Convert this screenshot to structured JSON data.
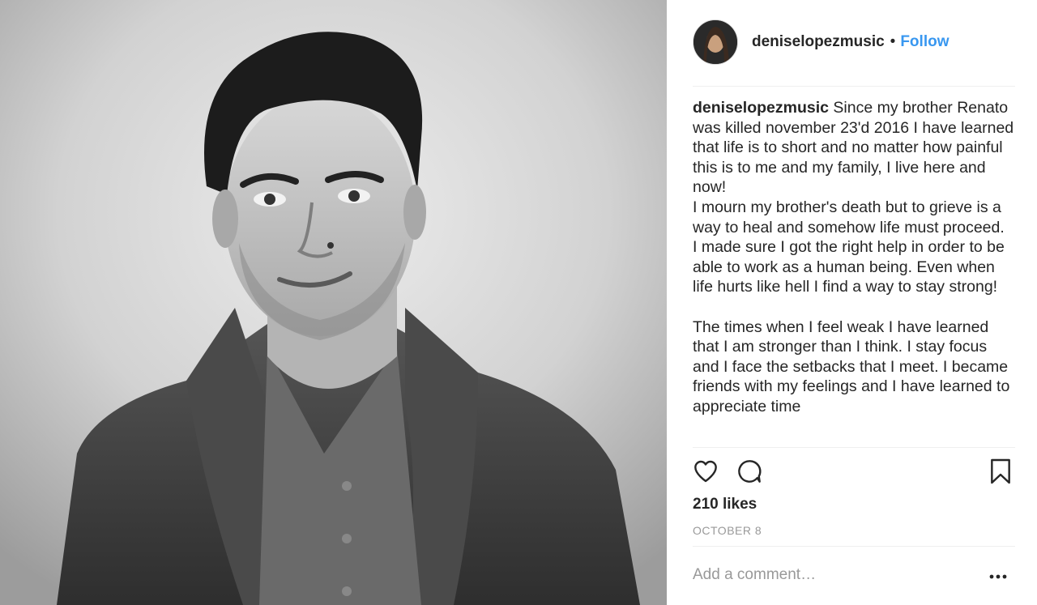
{
  "post": {
    "username": "deniselopezmusic",
    "separator": "•",
    "follow_label": "Follow",
    "caption_username": "deniselopezmusic",
    "caption_text": " Since my brother Renato was killed november 23'd 2016 I have learned that life is to short and no matter how painful this is to me and my family, I live here and now!\nI mourn my brother's death but to grieve is a way to heal and somehow life must proceed.\nI made sure I got the right help in order to be able to work as a human being. Even when life hurts like hell I find a way to stay strong!\n\nThe times when I feel weak I have learned that I am stronger than I think. I stay focus and I face the setbacks that I meet. I became friends with my feelings and I have learned to appreciate time",
    "likes": "210 likes",
    "date": "OCTOBER 8",
    "comment_placeholder": "Add a comment…"
  },
  "icons": {
    "like": "heart-icon",
    "comment": "comment-bubble-icon",
    "save": "bookmark-icon",
    "more": "more-dots-icon"
  },
  "colors": {
    "link": "#3897f0",
    "text": "#262626",
    "muted": "#999999",
    "divider": "#efefef"
  }
}
